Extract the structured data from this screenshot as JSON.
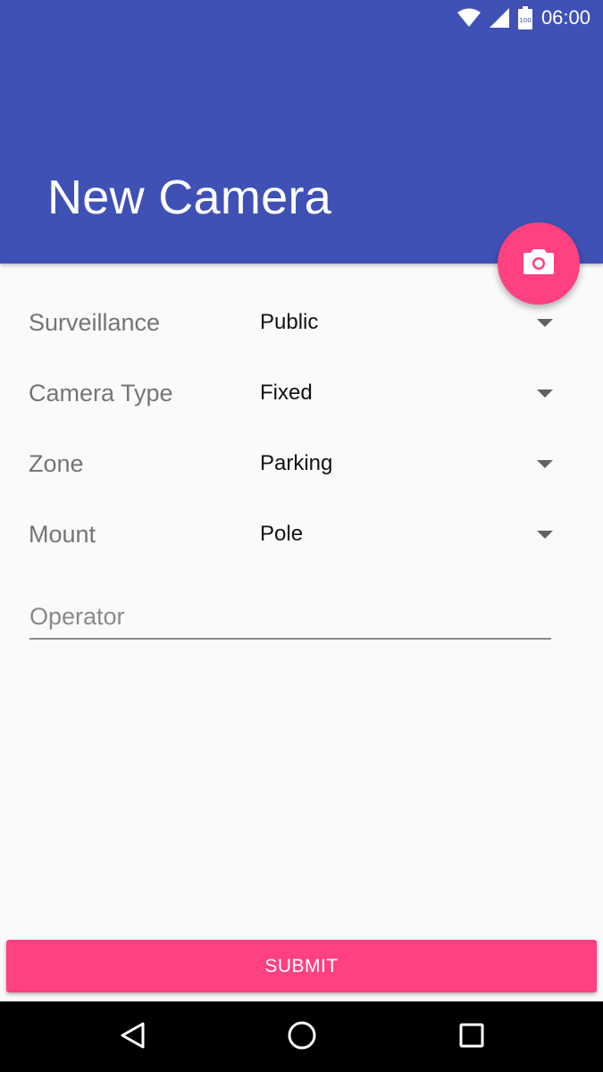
{
  "status_bar": {
    "time": "06:00",
    "battery_level": "100",
    "icons": [
      "wifi-icon",
      "signal-icon",
      "battery-icon"
    ]
  },
  "app_bar": {
    "title": "New Camera",
    "color": "#3f51b5"
  },
  "fab": {
    "icon": "camera-icon",
    "color": "#ff4081"
  },
  "form": {
    "surveillance": {
      "label": "Surveillance",
      "value": "Public"
    },
    "camera_type": {
      "label": "Camera Type",
      "value": "Fixed"
    },
    "zone": {
      "label": "Zone",
      "value": "Parking"
    },
    "mount": {
      "label": "Mount",
      "value": "Pole"
    },
    "operator": {
      "placeholder": "Operator",
      "value": ""
    }
  },
  "submit_button": {
    "label": "SUBMIT",
    "color": "#ff4081"
  },
  "nav_bar": {
    "buttons": [
      "back-icon",
      "home-icon",
      "recents-icon"
    ]
  }
}
